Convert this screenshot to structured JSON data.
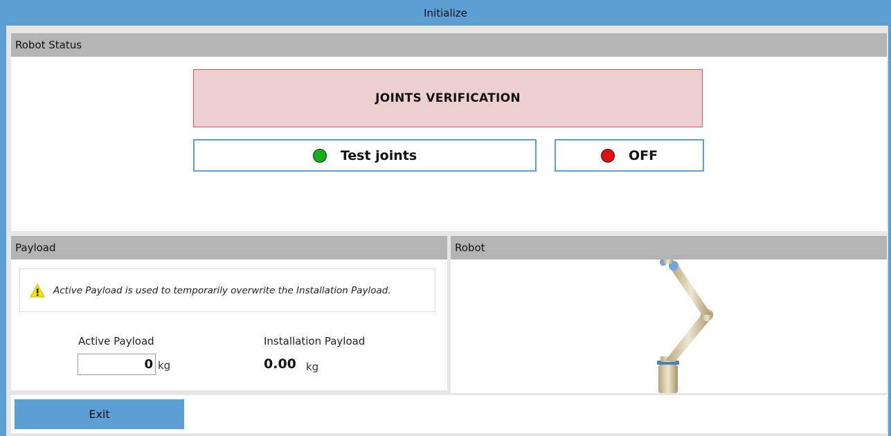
{
  "window": {
    "title": "Initialize"
  },
  "robot_status": {
    "header": "Robot Status",
    "state_label": "JOINTS VERIFICATION",
    "test_button_label": "Test joints",
    "power_button_label": "OFF",
    "colors": {
      "test_indicator": "#12b012",
      "power_indicator": "#e01010"
    }
  },
  "payload": {
    "header": "Payload",
    "note": "Active Payload is used to temporarily overwrite the Installation Payload.",
    "active_label": "Active Payload",
    "active_value": "0",
    "active_unit": "kg",
    "installation_label": "Installation Payload",
    "installation_value": "0.00",
    "installation_unit": "kg"
  },
  "robot": {
    "header": "Robot"
  },
  "footer": {
    "exit_label": "Exit"
  },
  "icons": {
    "warning": "warning-triangle-icon"
  },
  "colors": {
    "accent": "#5b9fd4",
    "header_bar": "#b4b4b4",
    "alert_bg": "#ecd0d0",
    "alert_border": "#e05252"
  }
}
